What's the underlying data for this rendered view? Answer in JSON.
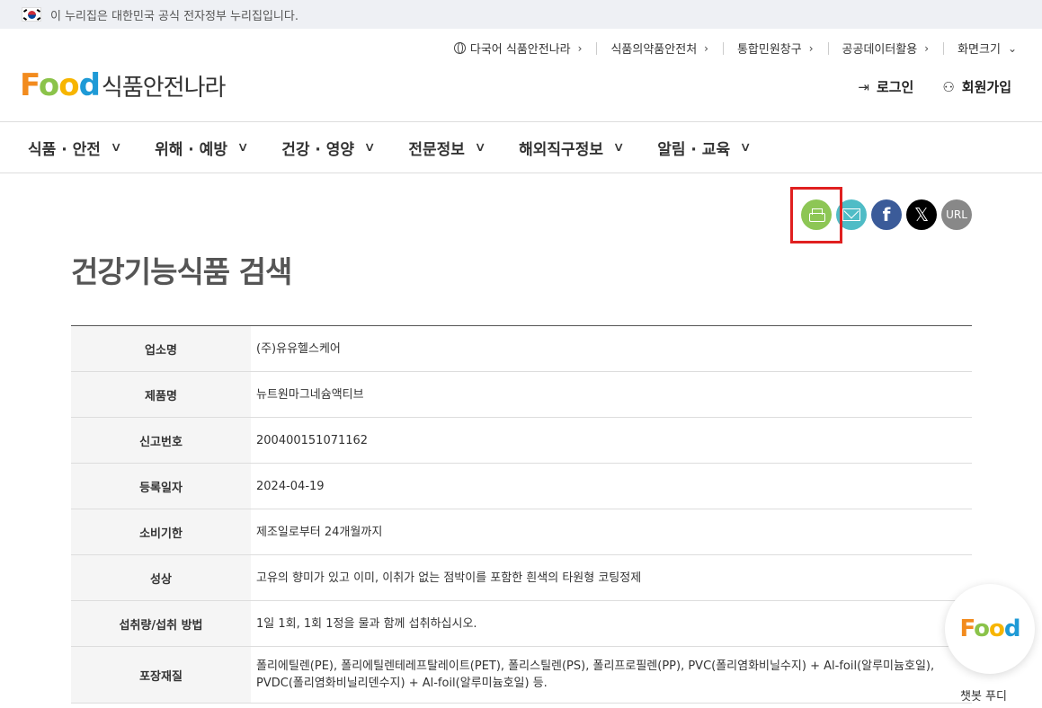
{
  "gov_banner": {
    "text": "이 누리집은 대한민국 공식 전자정부 누리집입니다."
  },
  "utility_nav": [
    {
      "label": "다국어 식품안전나라"
    },
    {
      "label": "식품의약품안전처"
    },
    {
      "label": "통합민원창구"
    },
    {
      "label": "공공데이터활용"
    },
    {
      "label": "화면크기"
    }
  ],
  "logo": {
    "f": "F",
    "o1": "o",
    "o2": "o",
    "d": "d",
    "site_name": "식품안전나라"
  },
  "member": {
    "login": "로그인",
    "signup": "회원가입"
  },
  "gnb": [
    {
      "label": "식품 · 안전"
    },
    {
      "label": "위해 · 예방"
    },
    {
      "label": "건강 · 영양"
    },
    {
      "label": "전문정보"
    },
    {
      "label": "해외직구정보"
    },
    {
      "label": "알림 · 교육"
    }
  ],
  "share": {
    "facebook": "f",
    "x": "𝕏",
    "url": "URL"
  },
  "page_title": "건강기능식품 검색",
  "product_info": [
    {
      "label": "업소명",
      "value": "(주)유유헬스케어"
    },
    {
      "label": "제품명",
      "value": "뉴트원마그네슘액티브"
    },
    {
      "label": "신고번호",
      "value": "200400151071162"
    },
    {
      "label": "등록일자",
      "value": "2024-04-19"
    },
    {
      "label": "소비기한",
      "value": "제조일로부터 24개월까지"
    },
    {
      "label": "성상",
      "value": "고유의 향미가 있고 이미, 이취가 없는 점박이를 포함한 흰색의 타원형 코팅정제"
    },
    {
      "label": "섭취량/섭취 방법",
      "value": "1일 1회, 1회 1정을 물과 함께 섭취하십시오."
    },
    {
      "label": "포장재질",
      "value": "폴리에틸렌(PE), 폴리에틸렌테레프탈레이트(PET), 폴리스틸렌(PS), 폴리프로필렌(PP), PVC(폴리염화비닐수지) + Al-foil(알루미늄호일), PVDC(폴리염화비닐리덴수지) + Al-foil(알루미늄호일) 등."
    }
  ],
  "chatbot": {
    "logo": "Food",
    "label": "챗봇 푸디"
  },
  "colors": {
    "highlight": "#e02020",
    "print": "#8dc655",
    "mail": "#4fbcc6",
    "facebook": "#3b5b99"
  }
}
